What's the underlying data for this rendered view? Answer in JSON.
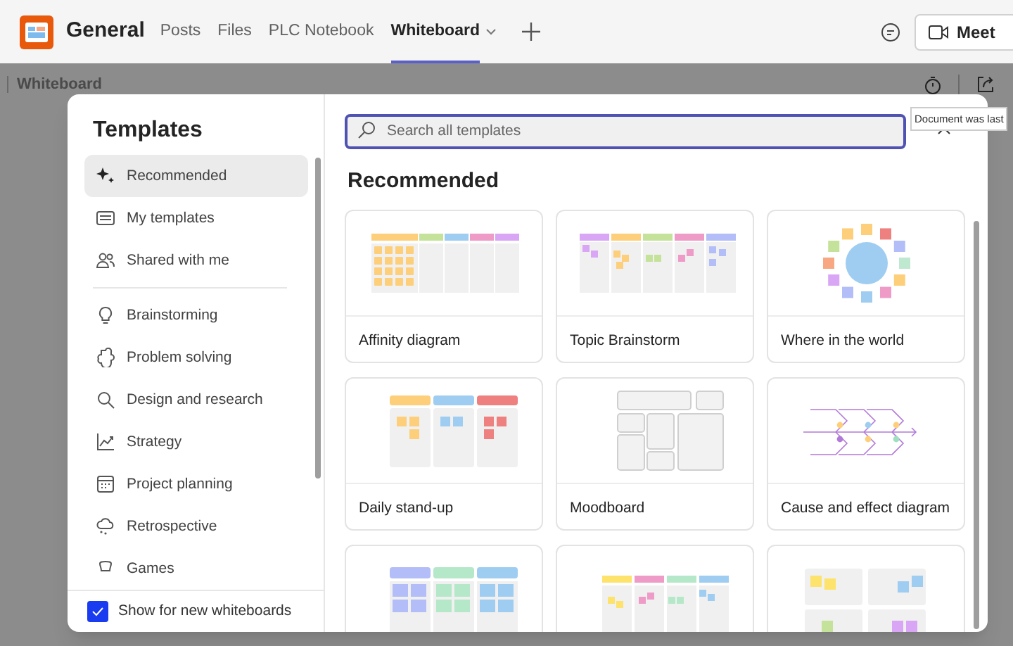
{
  "header": {
    "channel": "General",
    "tabs": [
      {
        "label": "Posts",
        "selected": false
      },
      {
        "label": "Files",
        "selected": false
      },
      {
        "label": "PLC Notebook",
        "selected": false
      },
      {
        "label": "Whiteboard",
        "selected": true
      }
    ],
    "meet_button": "Meet"
  },
  "whiteboard_bar": {
    "title": "Whiteboard"
  },
  "tooltip": "Document was last",
  "templates_dialog": {
    "title": "Templates",
    "sidebar": {
      "items": [
        {
          "label": "Recommended",
          "selected": true
        },
        {
          "label": "My templates",
          "selected": false
        },
        {
          "label": "Shared with me",
          "selected": false
        },
        {
          "kind": "divider"
        },
        {
          "label": "Brainstorming",
          "selected": false
        },
        {
          "label": "Problem solving",
          "selected": false
        },
        {
          "label": "Design and research",
          "selected": false
        },
        {
          "label": "Strategy",
          "selected": false
        },
        {
          "label": "Project planning",
          "selected": false
        },
        {
          "label": "Retrospective",
          "selected": false
        },
        {
          "label": "Games",
          "selected": false
        }
      ],
      "show_for_new": {
        "label": "Show for new whiteboards",
        "checked": true
      }
    },
    "search": {
      "placeholder": "Search all templates"
    },
    "section_title": "Recommended",
    "cards": [
      {
        "kind": "affinity",
        "title": "Affinity diagram"
      },
      {
        "kind": "topic",
        "title": "Topic Brainstorm"
      },
      {
        "kind": "world",
        "title": "Where in the world"
      },
      {
        "kind": "standup",
        "title": "Daily stand-up"
      },
      {
        "kind": "moodboard",
        "title": "Moodboard"
      },
      {
        "kind": "fishbone",
        "title": "Cause and effect diagram"
      },
      {
        "kind": "grid3"
      },
      {
        "kind": "columns4"
      },
      {
        "kind": "quadrants"
      }
    ]
  }
}
